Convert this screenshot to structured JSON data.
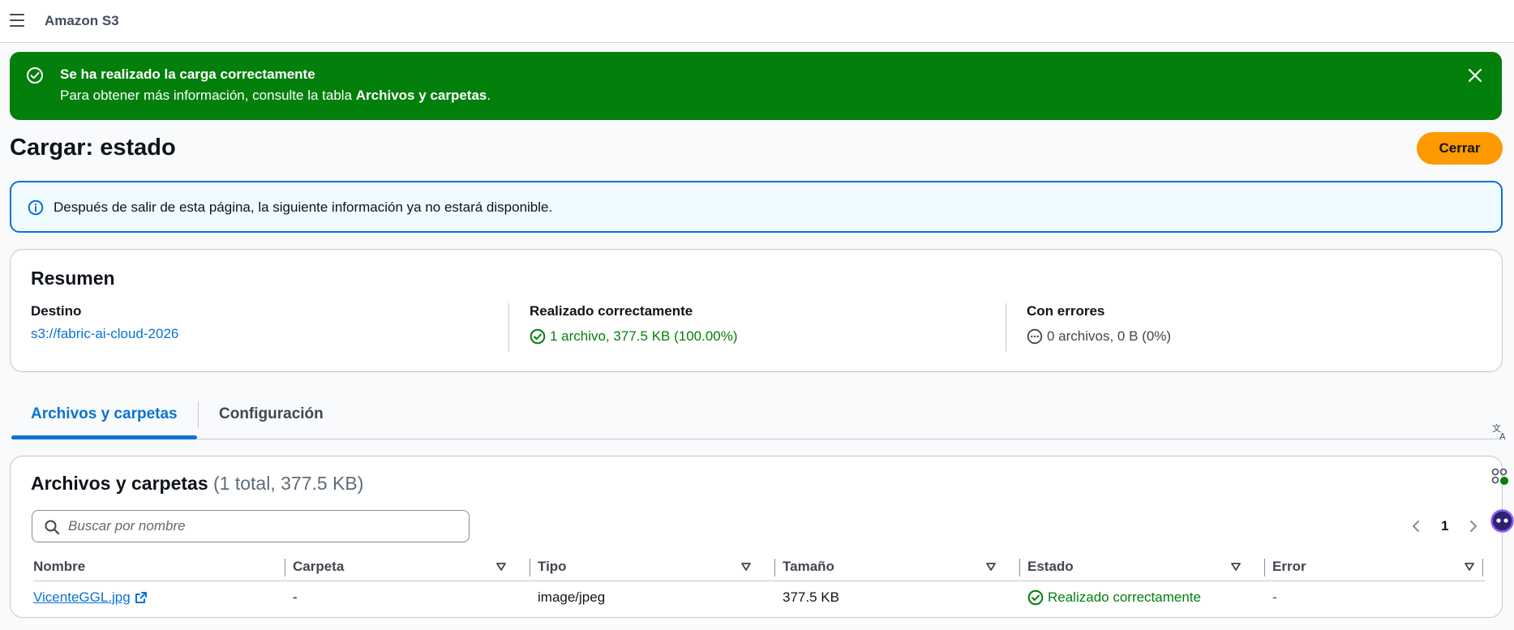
{
  "header": {
    "app_title": "Amazon S3"
  },
  "flash": {
    "title": "Se ha realizado la carga correctamente",
    "desc_prefix": "Para obtener más información, consulte la tabla ",
    "desc_bold": "Archivos y carpetas",
    "desc_suffix": "."
  },
  "page": {
    "title": "Cargar: estado",
    "close_label": "Cerrar"
  },
  "info": {
    "text": "Después de salir de esta página, la siguiente información ya no estará disponible."
  },
  "summary": {
    "title": "Resumen",
    "destination_label": "Destino",
    "destination_value": "s3://fabric-ai-cloud-2026",
    "success_label": "Realizado correctamente",
    "success_value": "1 archivo, 377.5 KB (100.00%)",
    "error_label": "Con errores",
    "error_value": "0 archivos, 0 B (0%)"
  },
  "tabs": [
    {
      "label": "Archivos y carpetas"
    },
    {
      "label": "Configuración"
    }
  ],
  "files": {
    "title": "Archivos y carpetas",
    "count": "(1 total, 377.5 KB)",
    "search_placeholder": "Buscar por nombre",
    "page": "1",
    "columns": [
      "Nombre",
      "Carpeta",
      "Tipo",
      "Tamaño",
      "Estado",
      "Error"
    ],
    "rows": [
      {
        "name": "VicenteGGL.jpg",
        "folder": "-",
        "type": "image/jpeg",
        "size": "377.5 KB",
        "status": "Realizado correctamente",
        "error": "-"
      }
    ]
  },
  "colors": {
    "success": "#037f0c",
    "primary": "#0972d3",
    "cta": "#ff9900"
  }
}
